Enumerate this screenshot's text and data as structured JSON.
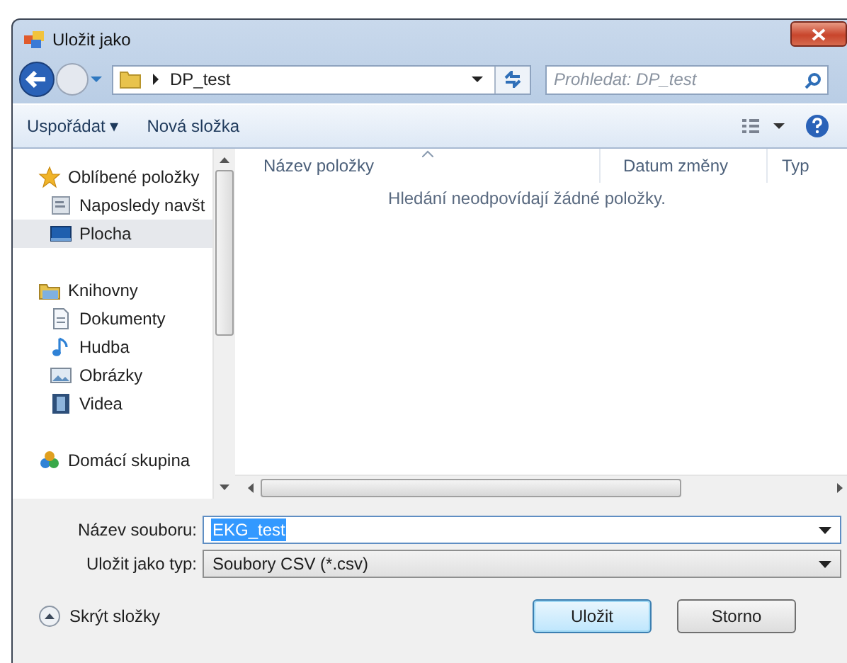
{
  "window": {
    "title": "Uložit jako"
  },
  "address": {
    "path": "DP_test",
    "search_placeholder": "Prohledat: DP_test"
  },
  "toolbar": {
    "items": [
      "Uspořádat ▾",
      "Nová složka"
    ]
  },
  "sidebar": {
    "items": [
      {
        "label": "Oblíbené položky",
        "selected": false,
        "children": [
          {
            "label": "Naposledy navšt",
            "selected": false
          },
          {
            "label": "Plocha",
            "selected": true
          }
        ]
      },
      {
        "label": "Knihovny",
        "selected": false,
        "children": [
          {
            "label": "Dokumenty",
            "selected": false
          },
          {
            "label": "Hudba",
            "selected": false
          },
          {
            "label": "Obrázky",
            "selected": false
          },
          {
            "label": "Videa",
            "selected": false
          }
        ]
      },
      {
        "label": "Domácí skupina",
        "selected": false
      }
    ]
  },
  "file_list": {
    "columns": [
      "Název položky",
      "Datum změny",
      "Typ"
    ],
    "empty_message": "Hledání neodpovídají žádné položky."
  },
  "form": {
    "filename_label": "Název souboru:",
    "filename": "EKG_test",
    "filename_selected": true,
    "type_label": "Uložit jako typ:",
    "type": "Soubory CSV (*.csv)"
  },
  "footer": {
    "toggle": "Skrýt složky",
    "buttons": [
      {
        "label": "Uložit",
        "default": true
      },
      {
        "label": "Storno",
        "default": false
      }
    ]
  }
}
